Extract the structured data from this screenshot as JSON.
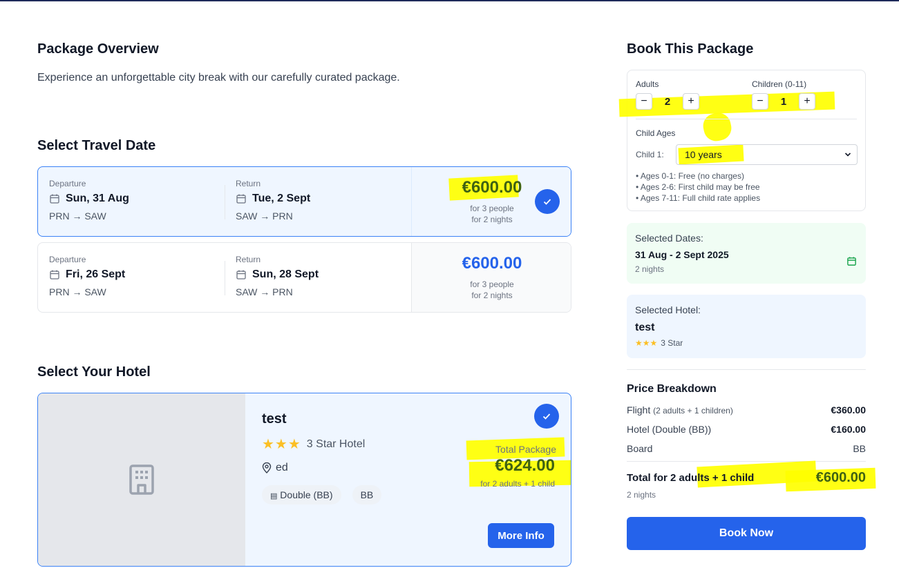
{
  "overview": {
    "title": "Package Overview",
    "description": "Experience an unforgettable city break with our carefully curated package."
  },
  "dates": {
    "title": "Select Travel Date",
    "departure_label": "Departure",
    "return_label": "Return",
    "options": [
      {
        "departure": "Sun, 31 Aug",
        "dep_route": "PRN → SAW",
        "return": "Tue, 2 Sept",
        "ret_route": "SAW → PRN",
        "price": "€600.00",
        "people": "for 3 people",
        "nights": "for 2 nights",
        "selected": true
      },
      {
        "departure": "Fri, 26 Sept",
        "dep_route": "PRN → SAW",
        "return": "Sun, 28 Sept",
        "ret_route": "SAW → PRN",
        "price": "€600.00",
        "people": "for 3 people",
        "nights": "for 2 nights",
        "selected": false
      }
    ]
  },
  "hotel": {
    "section_title": "Select Your Hotel",
    "name": "test",
    "stars": 3,
    "rating_text": "3 Star Hotel",
    "location": "ed",
    "room_chip": "Double (BB)",
    "board_chip": "BB",
    "total_label": "Total Package",
    "total_price": "€624.00",
    "total_sub": "for 2 adults + 1 child",
    "more_info": "More Info"
  },
  "booking": {
    "title": "Book This Package",
    "adults_label": "Adults",
    "adults_value": "2",
    "children_label": "Children (0-11)",
    "children_value": "1",
    "child_ages_label": "Child Ages",
    "child1_label": "Child 1:",
    "child1_value": "10 years",
    "age_notes": [
      "• Ages 0-1: Free (no charges)",
      "• Ages 2-6: First child may be free",
      "• Ages 7-11: Full child rate applies"
    ]
  },
  "selected_dates": {
    "label": "Selected Dates:",
    "value": "31 Aug - 2 Sept 2025",
    "nights": "2 nights"
  },
  "selected_hotel": {
    "label": "Selected Hotel:",
    "name": "test",
    "stars": 3,
    "rating_text": "3 Star"
  },
  "breakdown": {
    "title": "Price Breakdown",
    "flight_label": "Flight",
    "flight_detail": "(2 adults + 1 children)",
    "flight_value": "€360.00",
    "hotel_label": "Hotel (Double (BB))",
    "hotel_value": "€160.00",
    "board_label": "Board",
    "board_value": "BB",
    "total_label": "Total for 2 adults + 1 child",
    "total_value": "€600.00",
    "nights": "2 nights",
    "book_now": "Book Now"
  },
  "colors": {
    "accent": "#2563eb",
    "highlighter": "#ffff00",
    "star": "#fbbf24",
    "green": "#16a34a"
  }
}
